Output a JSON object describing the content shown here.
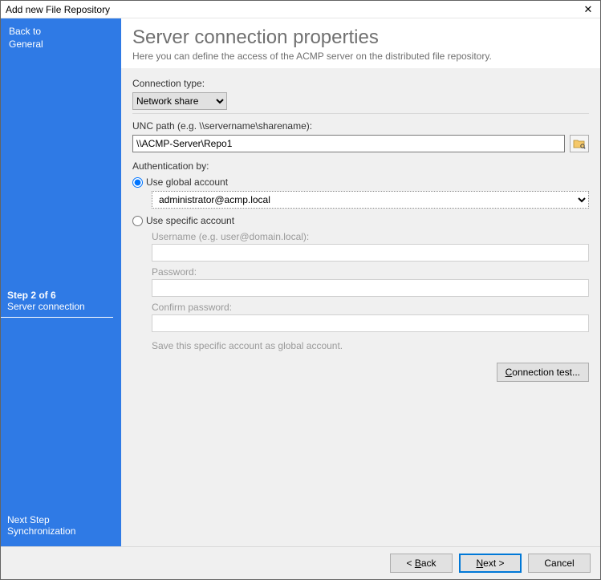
{
  "window": {
    "title": "Add new File Repository"
  },
  "sidebar": {
    "back_top": "Back to",
    "back_bottom": "General",
    "step_of": "Step 2 of 6",
    "step_name": "Server connection",
    "next_top": "Next Step",
    "next_bottom": "Synchronization"
  },
  "header": {
    "title": "Server connection properties",
    "subtitle": "Here you can define the access of the ACMP server on the distributed file repository."
  },
  "form": {
    "connection_type_label": "Connection type:",
    "connection_type_value": "Network share",
    "unc_label": "UNC path (e.g. \\\\servername\\sharename):",
    "unc_value": "\\\\ACMP-Server\\Repo1",
    "auth_label": "Authentication by:",
    "use_global_label": "Use global account",
    "global_account_value": "administrator@acmp.local",
    "use_specific_label": "Use specific account",
    "username_label": "Username (e.g. user@domain.local):",
    "password_label": "Password:",
    "confirm_label": "Confirm password:",
    "save_hint": "Save this specific account as global account.",
    "conn_test_pre": "C",
    "conn_test_rest": "onnection test..."
  },
  "footer": {
    "back_lt": "< ",
    "back_u": "B",
    "back_rest": "ack",
    "next_u": "N",
    "next_rest": "ext >",
    "cancel": "Cancel"
  }
}
